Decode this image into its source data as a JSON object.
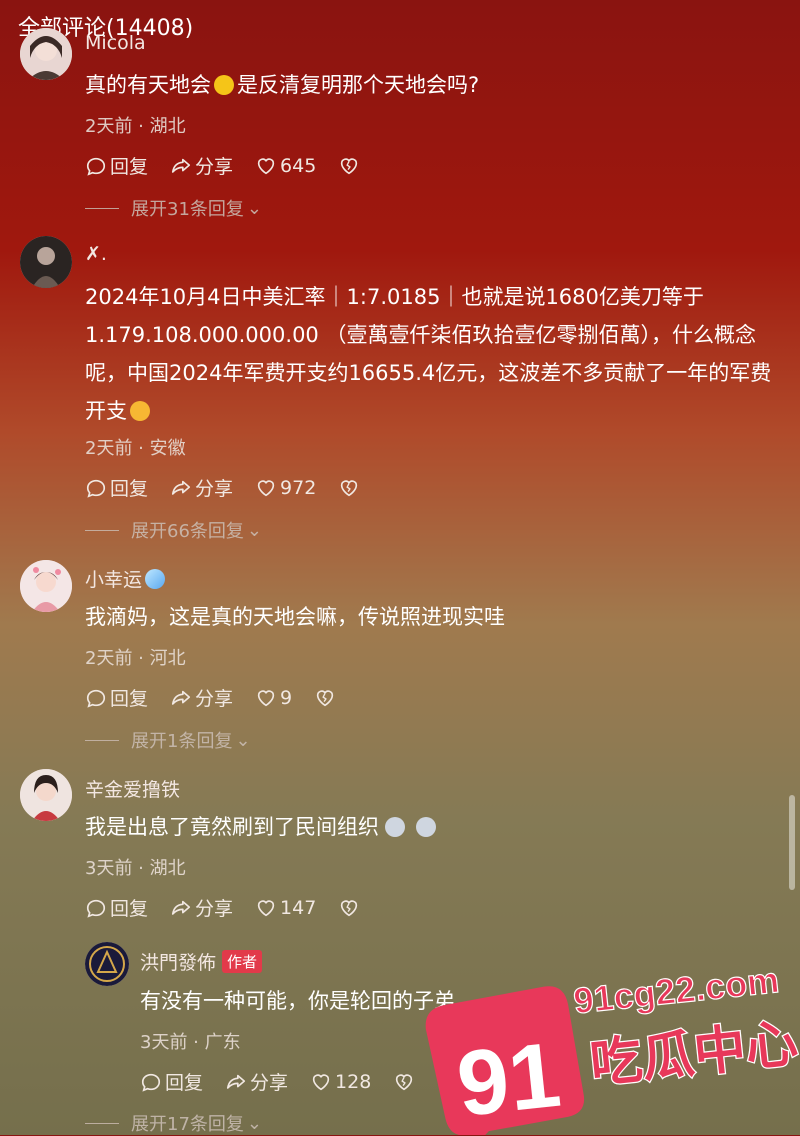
{
  "header": {
    "title": "全部评论(14408)"
  },
  "labels": {
    "reply": "回复",
    "share": "分享"
  },
  "comments": [
    {
      "username": "Micola",
      "text": "真的有天地会",
      "text_suffix": "是反清复明那个天地会吗?",
      "time_location": "2天前 · 湖北",
      "likes": "645",
      "expand": "展开31条回复"
    },
    {
      "username": "✗.",
      "text": "2024年10月4日中美汇率｜1:7.0185｜也就是说1680亿美刀等于1.179.108.000.000.00 （壹萬壹仟柒佰玖拾壹亿零捌佰萬），什么概念呢，中国2024年军费开支约16655.4亿元，这波差不多贡献了一年的军费开支",
      "time_location": "2天前 · 安徽",
      "likes": "972",
      "expand": "展开66条回复"
    },
    {
      "username": "小幸运",
      "text": "我滴妈，这是真的天地会嘛，传说照进现实哇",
      "time_location": "2天前 · 河北",
      "likes": "9",
      "expand": "展开1条回复"
    },
    {
      "username": "辛金爱撸铁",
      "text": "我是出息了竟然刷到了民间组织",
      "time_location": "3天前 · 湖北",
      "likes": "147"
    }
  ],
  "reply": {
    "username": "洪門發佈",
    "badge": "作者",
    "text": "有没有一种可能，你是轮回的子弟",
    "time_location": "3天前 · 广东",
    "likes": "128",
    "expand": "展开17条回复"
  },
  "watermark": {
    "number": "91",
    "site": "91cg22.com",
    "name": "吃瓜中心"
  },
  "colors": {
    "accent_badge": "#e23a4a",
    "watermark_pink": "#e8385a"
  }
}
